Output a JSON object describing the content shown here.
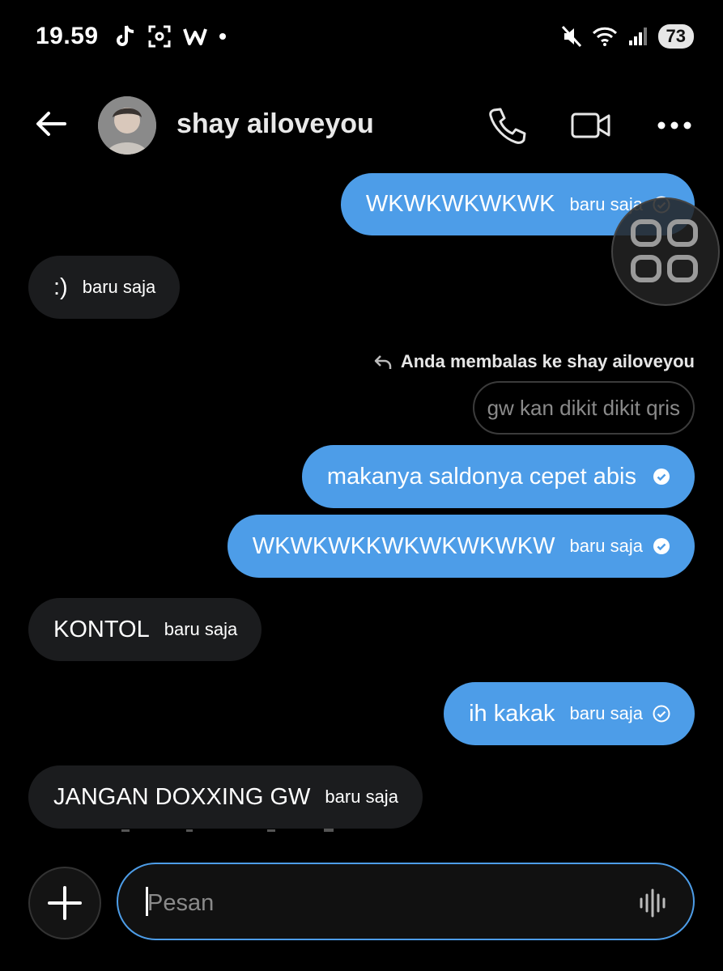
{
  "status_bar": {
    "time": "19.59",
    "battery": "73",
    "left_icons": [
      "tiktok-icon",
      "screen-capture-icon",
      "w-app-icon",
      "dot-icon"
    ],
    "right_icons": [
      "mute-icon",
      "wifi-icon",
      "signal-icon"
    ]
  },
  "header": {
    "contact_name": "shay ailoveyou",
    "icons": [
      "back-arrow-icon",
      "phone-icon",
      "video-call-icon",
      "more-icon"
    ]
  },
  "messages": [
    {
      "side": "out",
      "text": "WKWKWKWKWK",
      "time": "baru saja",
      "status": "sent"
    },
    {
      "side": "in",
      "text": ":)",
      "time": "baru saja"
    },
    {
      "side": "out",
      "text": "makanya saldonya cepet abis",
      "time": "",
      "status": "read"
    },
    {
      "side": "out",
      "text": "WKWKWKKWKWKWKWKW",
      "time": "baru saja",
      "status": "read"
    },
    {
      "side": "in",
      "text": "KONTOL",
      "time": "baru saja"
    },
    {
      "side": "out",
      "text": "ih kakak",
      "time": "baru saja",
      "status": "sent"
    },
    {
      "side": "in",
      "text": "JANGAN DOXXING GW",
      "time": "baru saja"
    }
  ],
  "reply": {
    "hint": "Anda membalas ke shay ailoveyou",
    "quoted_text": "gw kan dikit dikit qris"
  },
  "composer": {
    "placeholder": "Pesan"
  },
  "colors": {
    "background": "#000000",
    "outgoing_bubble": "#4d9de8",
    "incoming_bubble": "#1b1c1e",
    "accent": "#4d9de8"
  }
}
